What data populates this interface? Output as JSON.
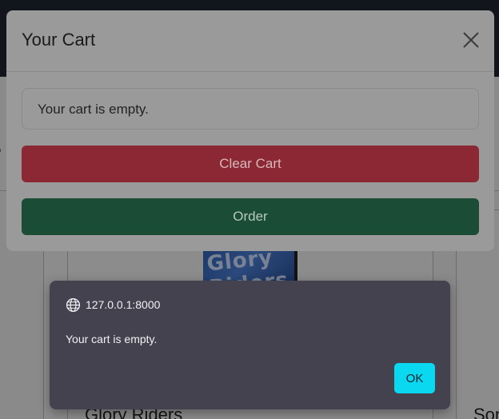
{
  "background": {
    "partial_heading": "r",
    "product_title": "Glory Riders",
    "product_title_next": "Son",
    "product_image_text": "Glory Riders"
  },
  "cart_modal": {
    "title": "Your Cart",
    "close_icon": "close-icon",
    "empty_message": "Your cart is empty.",
    "clear_label": "Clear Cart",
    "order_label": "Order",
    "colors": {
      "clear": "#dc3545",
      "order": "#198754"
    }
  },
  "alert": {
    "origin": "127.0.0.1:8000",
    "origin_icon": "globe-icon",
    "message": "Your cart is empty.",
    "ok_label": "OK",
    "ok_color": "#0ad7f0"
  }
}
